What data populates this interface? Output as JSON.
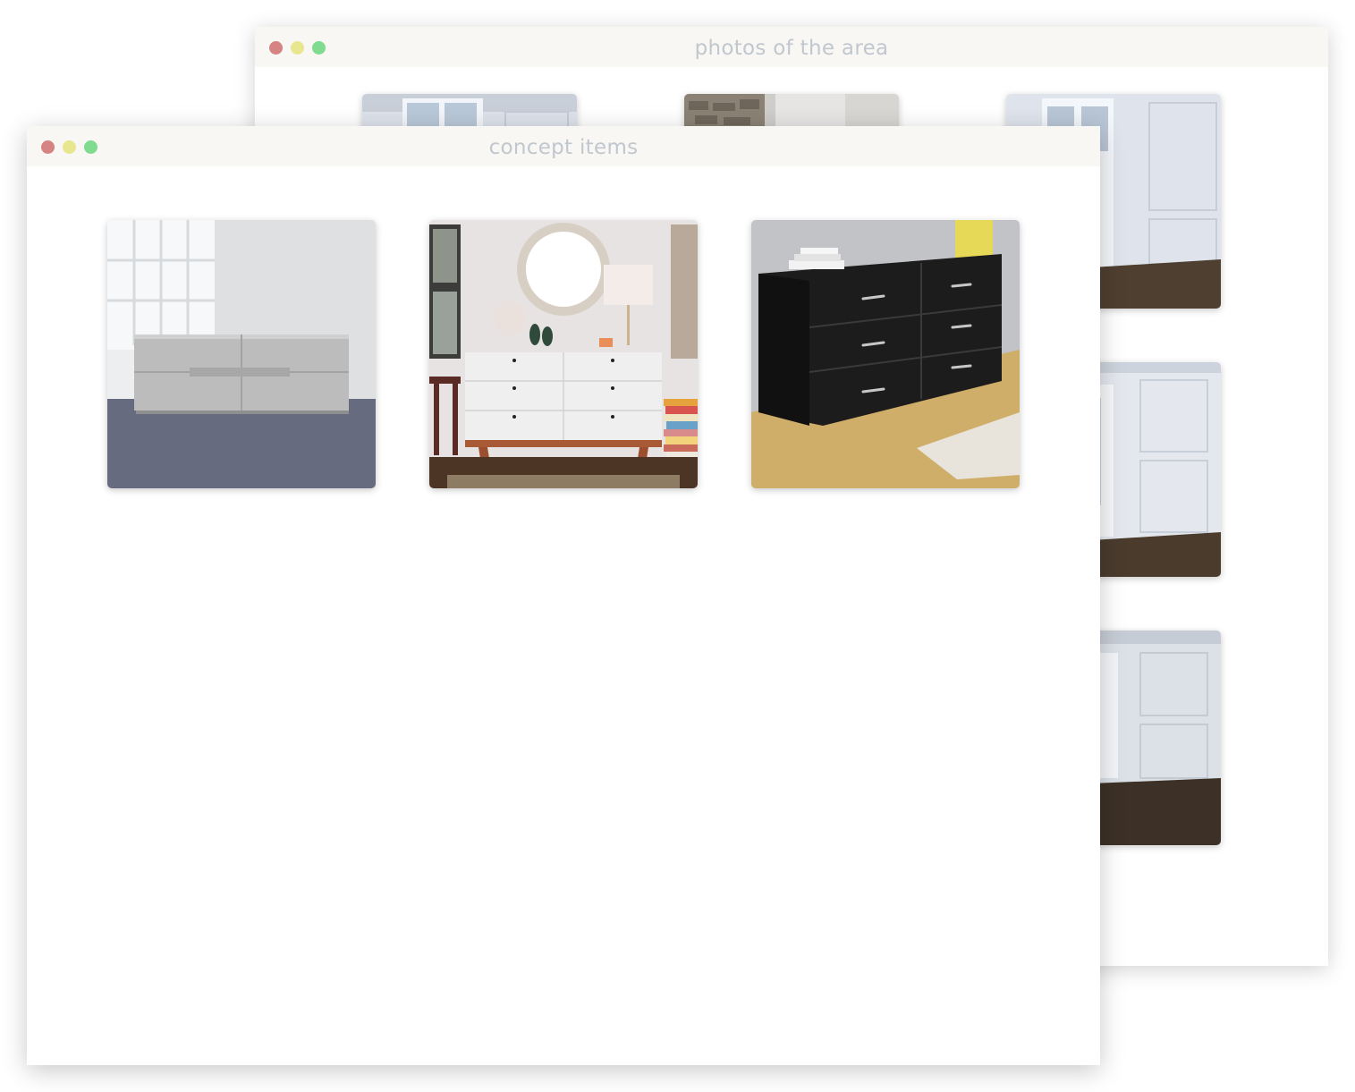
{
  "colors": {
    "close": "#d68383",
    "minimize": "#e9e690",
    "zoom": "#7fdb8e",
    "titlebar_bg": "#f8f7f3",
    "title_text": "#c1c7cf"
  },
  "back_window": {
    "title": "photos of the area",
    "photos": [
      {
        "subject": "empty room with paneled walls and window"
      },
      {
        "subject": "room with stone brick wall"
      },
      {
        "subject": "empty room with balcony door and herringbone floor"
      },
      {
        "subject": "empty room with open french doors and herringbone floor"
      },
      {
        "subject": "empty room with molding walls and dark parquet floor"
      }
    ]
  },
  "front_window": {
    "title": "concept items",
    "items": [
      {
        "subject": "grey low dresser in white room"
      },
      {
        "subject": "white dresser with wooden legs and round mirror"
      },
      {
        "subject": "black six-drawer dresser on wood floor"
      }
    ]
  }
}
